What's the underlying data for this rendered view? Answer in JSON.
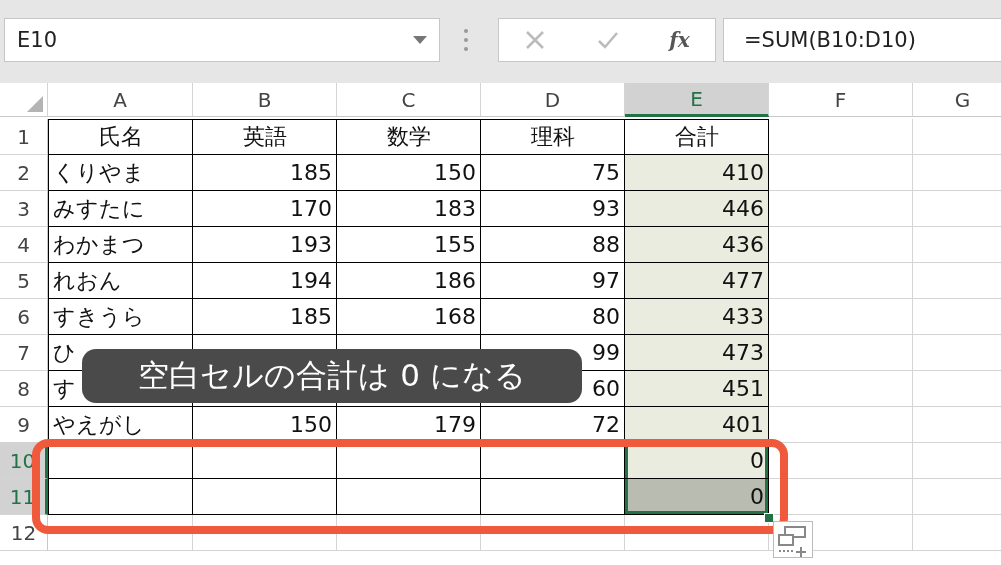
{
  "name_box": {
    "value": "E10"
  },
  "formula_bar": {
    "fx_label": "fx",
    "value": "=SUM(B10:D10)"
  },
  "columns": [
    {
      "label": "A",
      "selected": false
    },
    {
      "label": "B",
      "selected": false
    },
    {
      "label": "C",
      "selected": false
    },
    {
      "label": "D",
      "selected": false
    },
    {
      "label": "E",
      "selected": true
    },
    {
      "label": "F",
      "selected": false
    },
    {
      "label": "G",
      "selected": false
    }
  ],
  "rows": [
    {
      "number": "1",
      "selected": false,
      "kind": "header",
      "total_shaded": false,
      "total_selected": false,
      "total_active": false,
      "cells": [
        "氏名",
        "英語",
        "数学",
        "理科",
        "合計"
      ]
    },
    {
      "number": "2",
      "selected": false,
      "kind": "data",
      "total_shaded": true,
      "total_selected": false,
      "total_active": false,
      "cells": [
        "くりやま",
        "185",
        "150",
        "75",
        "410"
      ]
    },
    {
      "number": "3",
      "selected": false,
      "kind": "data",
      "total_shaded": true,
      "total_selected": false,
      "total_active": false,
      "cells": [
        "みすたに",
        "170",
        "183",
        "93",
        "446"
      ]
    },
    {
      "number": "4",
      "selected": false,
      "kind": "data",
      "total_shaded": true,
      "total_selected": false,
      "total_active": false,
      "cells": [
        "わかまつ",
        "193",
        "155",
        "88",
        "436"
      ]
    },
    {
      "number": "5",
      "selected": false,
      "kind": "data",
      "total_shaded": true,
      "total_selected": false,
      "total_active": false,
      "cells": [
        "れおん",
        "194",
        "186",
        "97",
        "477"
      ]
    },
    {
      "number": "6",
      "selected": false,
      "kind": "data",
      "total_shaded": true,
      "total_selected": false,
      "total_active": false,
      "cells": [
        "すきうら",
        "185",
        "168",
        "80",
        "433"
      ]
    },
    {
      "number": "7",
      "selected": false,
      "kind": "data",
      "total_shaded": true,
      "total_selected": false,
      "total_active": false,
      "cells": [
        "ひ",
        null,
        null,
        "99",
        "473"
      ]
    },
    {
      "number": "8",
      "selected": false,
      "kind": "data",
      "total_shaded": true,
      "total_selected": false,
      "total_active": false,
      "cells": [
        "す",
        null,
        null,
        "60",
        "451"
      ]
    },
    {
      "number": "9",
      "selected": false,
      "kind": "data",
      "total_shaded": true,
      "total_selected": false,
      "total_active": false,
      "cells": [
        "やえがし",
        "150",
        "179",
        "72",
        "401"
      ]
    },
    {
      "number": "10",
      "selected": true,
      "kind": "data",
      "total_shaded": true,
      "total_selected": true,
      "total_active": true,
      "cells": [
        null,
        null,
        null,
        null,
        "0"
      ]
    },
    {
      "number": "11",
      "selected": true,
      "kind": "data",
      "total_shaded": true,
      "total_selected": true,
      "total_active": false,
      "cells": [
        null,
        null,
        null,
        null,
        "0"
      ]
    },
    {
      "number": "12",
      "selected": false,
      "kind": "blank",
      "total_shaded": false,
      "total_selected": false,
      "total_active": false,
      "cells": []
    }
  ],
  "caption": {
    "text": "空白セルの合計は 0 になる"
  }
}
